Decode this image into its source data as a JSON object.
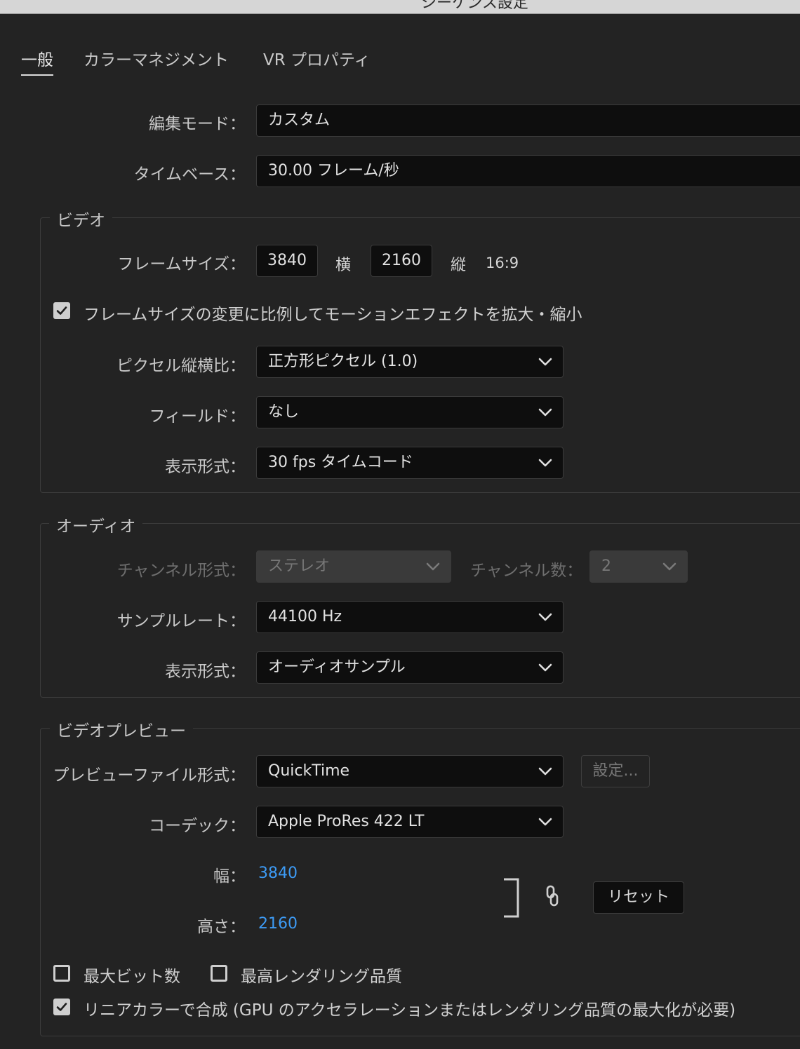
{
  "window": {
    "title": "シーケンス設定"
  },
  "tabs": [
    {
      "label": "一般",
      "active": true
    },
    {
      "label": "カラーマネジメント",
      "active": false
    },
    {
      "label": "VR プロパティ",
      "active": false
    }
  ],
  "general": {
    "edit_mode": {
      "label": "編集モード：",
      "value": "カスタム"
    },
    "timebase": {
      "label": "タイムベース：",
      "value": "30.00  フレーム/秒"
    }
  },
  "video": {
    "title": "ビデオ",
    "frame_size": {
      "label": "フレームサイズ：",
      "width": "3840",
      "h_label": "横",
      "height": "2160",
      "v_label": "縦",
      "ratio": "16:9"
    },
    "scale_motion": {
      "checked": true,
      "label": "フレームサイズの変更に比例してモーションエフェクトを拡大・縮小"
    },
    "pixel_aspect": {
      "label": "ピクセル縦横比：",
      "value": "正方形ピクセル (1.0)"
    },
    "fields": {
      "label": "フィールド：",
      "value": "なし"
    },
    "display_format": {
      "label": "表示形式：",
      "value": "30 fps タイムコード"
    }
  },
  "audio": {
    "title": "オーディオ",
    "channel_format": {
      "label": "チャンネル形式：",
      "value": "ステレオ"
    },
    "channel_count": {
      "label": "チャンネル数：",
      "value": "2"
    },
    "sample_rate": {
      "label": "サンプルレート：",
      "value": "44100 Hz"
    },
    "display_format": {
      "label": "表示形式：",
      "value": "オーディオサンプル"
    }
  },
  "video_preview": {
    "title": "ビデオプレビュー",
    "file_format": {
      "label": "プレビューファイル形式：",
      "value": "QuickTime"
    },
    "settings_button": "設定...",
    "codec": {
      "label": "コーデック：",
      "value": "Apple ProRes 422 LT"
    },
    "width": {
      "label": "幅：",
      "value": "3840"
    },
    "height": {
      "label": "高さ：",
      "value": "2160"
    },
    "reset_button": "リセット",
    "max_bit_depth": {
      "checked": false,
      "label": "最大ビット数"
    },
    "max_render_quality": {
      "checked": false,
      "label": "最高レンダリング品質"
    },
    "linear_color": {
      "checked": true,
      "label": "リニアカラーで合成 (GPU のアクセラレーションまたはレンダリング品質の最大化が必要)"
    }
  },
  "icons": {
    "chevron": "chevron-down-icon",
    "check": "checkmark-icon",
    "link": "link-icon",
    "bracket": "bracket-icon"
  }
}
